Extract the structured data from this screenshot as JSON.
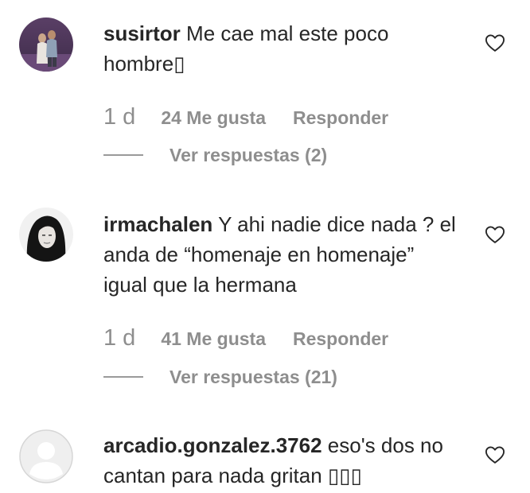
{
  "comments": [
    {
      "username": "susirtor",
      "text": "Me cae mal este poco hombre▯",
      "time": "1 d",
      "likes": "24 Me gusta",
      "reply": "Responder",
      "view_replies": "Ver respuestas (2)",
      "avatar_icon": "user-photo-avatar"
    },
    {
      "username": "irmachalen",
      "text": "Y ahi nadie dice nada ? el anda de “homenaje en homenaje” igual que la hermana",
      "time": "1 d",
      "likes": "41 Me gusta",
      "reply": "Responder",
      "view_replies": "Ver respuestas (21)",
      "avatar_icon": "user-photo-avatar"
    },
    {
      "username": "arcadio.gonzalez.3762",
      "text": "eso's dos no cantan para nada gritan ▯▯▯",
      "avatar_icon": "default-profile-avatar"
    }
  ],
  "colors": {
    "text": "#262626",
    "secondary": "#8e8e8e",
    "background": "#ffffff"
  },
  "icons": {
    "like": "heart-outline-icon"
  }
}
